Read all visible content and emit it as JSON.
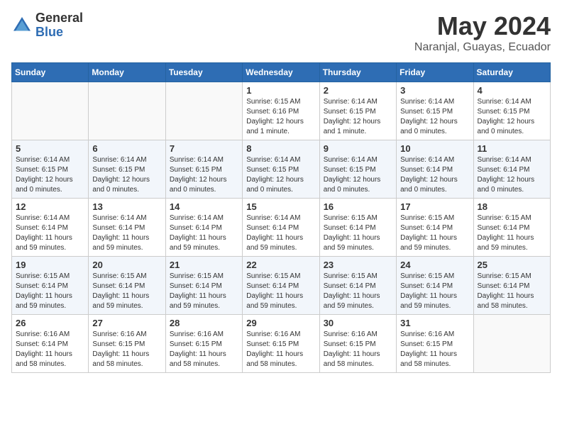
{
  "header": {
    "logo_general": "General",
    "logo_blue": "Blue",
    "month_title": "May 2024",
    "location": "Naranjal, Guayas, Ecuador"
  },
  "days_of_week": [
    "Sunday",
    "Monday",
    "Tuesday",
    "Wednesday",
    "Thursday",
    "Friday",
    "Saturday"
  ],
  "weeks": [
    [
      {
        "day": "",
        "info": ""
      },
      {
        "day": "",
        "info": ""
      },
      {
        "day": "",
        "info": ""
      },
      {
        "day": "1",
        "info": "Sunrise: 6:15 AM\nSunset: 6:16 PM\nDaylight: 12 hours\nand 1 minute."
      },
      {
        "day": "2",
        "info": "Sunrise: 6:14 AM\nSunset: 6:15 PM\nDaylight: 12 hours\nand 1 minute."
      },
      {
        "day": "3",
        "info": "Sunrise: 6:14 AM\nSunset: 6:15 PM\nDaylight: 12 hours\nand 0 minutes."
      },
      {
        "day": "4",
        "info": "Sunrise: 6:14 AM\nSunset: 6:15 PM\nDaylight: 12 hours\nand 0 minutes."
      }
    ],
    [
      {
        "day": "5",
        "info": "Sunrise: 6:14 AM\nSunset: 6:15 PM\nDaylight: 12 hours\nand 0 minutes."
      },
      {
        "day": "6",
        "info": "Sunrise: 6:14 AM\nSunset: 6:15 PM\nDaylight: 12 hours\nand 0 minutes."
      },
      {
        "day": "7",
        "info": "Sunrise: 6:14 AM\nSunset: 6:15 PM\nDaylight: 12 hours\nand 0 minutes."
      },
      {
        "day": "8",
        "info": "Sunrise: 6:14 AM\nSunset: 6:15 PM\nDaylight: 12 hours\nand 0 minutes."
      },
      {
        "day": "9",
        "info": "Sunrise: 6:14 AM\nSunset: 6:15 PM\nDaylight: 12 hours\nand 0 minutes."
      },
      {
        "day": "10",
        "info": "Sunrise: 6:14 AM\nSunset: 6:14 PM\nDaylight: 12 hours\nand 0 minutes."
      },
      {
        "day": "11",
        "info": "Sunrise: 6:14 AM\nSunset: 6:14 PM\nDaylight: 12 hours\nand 0 minutes."
      }
    ],
    [
      {
        "day": "12",
        "info": "Sunrise: 6:14 AM\nSunset: 6:14 PM\nDaylight: 11 hours\nand 59 minutes."
      },
      {
        "day": "13",
        "info": "Sunrise: 6:14 AM\nSunset: 6:14 PM\nDaylight: 11 hours\nand 59 minutes."
      },
      {
        "day": "14",
        "info": "Sunrise: 6:14 AM\nSunset: 6:14 PM\nDaylight: 11 hours\nand 59 minutes."
      },
      {
        "day": "15",
        "info": "Sunrise: 6:14 AM\nSunset: 6:14 PM\nDaylight: 11 hours\nand 59 minutes."
      },
      {
        "day": "16",
        "info": "Sunrise: 6:15 AM\nSunset: 6:14 PM\nDaylight: 11 hours\nand 59 minutes."
      },
      {
        "day": "17",
        "info": "Sunrise: 6:15 AM\nSunset: 6:14 PM\nDaylight: 11 hours\nand 59 minutes."
      },
      {
        "day": "18",
        "info": "Sunrise: 6:15 AM\nSunset: 6:14 PM\nDaylight: 11 hours\nand 59 minutes."
      }
    ],
    [
      {
        "day": "19",
        "info": "Sunrise: 6:15 AM\nSunset: 6:14 PM\nDaylight: 11 hours\nand 59 minutes."
      },
      {
        "day": "20",
        "info": "Sunrise: 6:15 AM\nSunset: 6:14 PM\nDaylight: 11 hours\nand 59 minutes."
      },
      {
        "day": "21",
        "info": "Sunrise: 6:15 AM\nSunset: 6:14 PM\nDaylight: 11 hours\nand 59 minutes."
      },
      {
        "day": "22",
        "info": "Sunrise: 6:15 AM\nSunset: 6:14 PM\nDaylight: 11 hours\nand 59 minutes."
      },
      {
        "day": "23",
        "info": "Sunrise: 6:15 AM\nSunset: 6:14 PM\nDaylight: 11 hours\nand 59 minutes."
      },
      {
        "day": "24",
        "info": "Sunrise: 6:15 AM\nSunset: 6:14 PM\nDaylight: 11 hours\nand 59 minutes."
      },
      {
        "day": "25",
        "info": "Sunrise: 6:15 AM\nSunset: 6:14 PM\nDaylight: 11 hours\nand 58 minutes."
      }
    ],
    [
      {
        "day": "26",
        "info": "Sunrise: 6:16 AM\nSunset: 6:14 PM\nDaylight: 11 hours\nand 58 minutes."
      },
      {
        "day": "27",
        "info": "Sunrise: 6:16 AM\nSunset: 6:15 PM\nDaylight: 11 hours\nand 58 minutes."
      },
      {
        "day": "28",
        "info": "Sunrise: 6:16 AM\nSunset: 6:15 PM\nDaylight: 11 hours\nand 58 minutes."
      },
      {
        "day": "29",
        "info": "Sunrise: 6:16 AM\nSunset: 6:15 PM\nDaylight: 11 hours\nand 58 minutes."
      },
      {
        "day": "30",
        "info": "Sunrise: 6:16 AM\nSunset: 6:15 PM\nDaylight: 11 hours\nand 58 minutes."
      },
      {
        "day": "31",
        "info": "Sunrise: 6:16 AM\nSunset: 6:15 PM\nDaylight: 11 hours\nand 58 minutes."
      },
      {
        "day": "",
        "info": ""
      }
    ]
  ]
}
